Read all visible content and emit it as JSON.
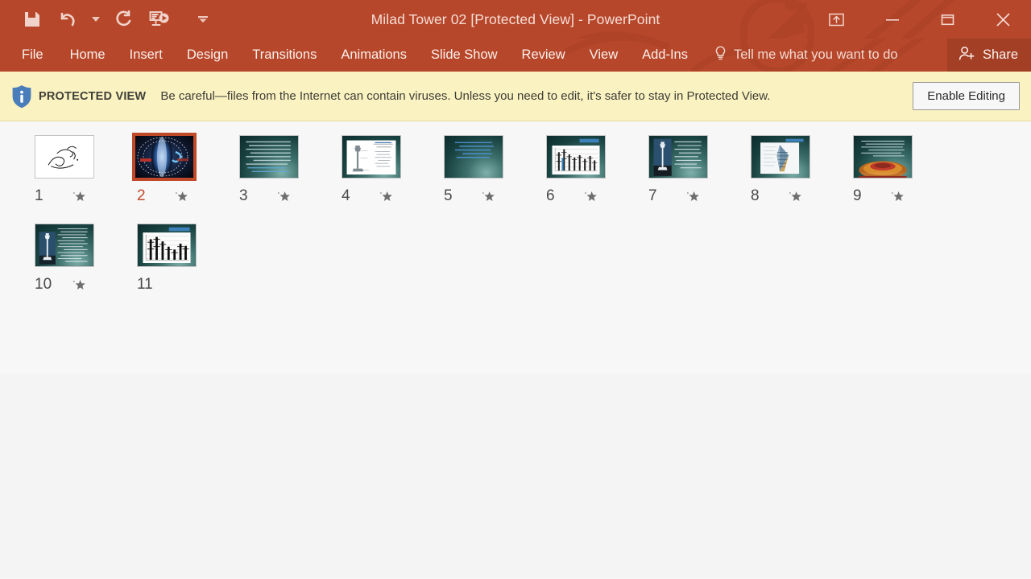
{
  "window": {
    "title": "Milad Tower 02 [Protected View] - PowerPoint",
    "accent_color": "#b7472a",
    "share_bg": "#a23f25"
  },
  "quick_access": [
    {
      "name": "save",
      "icon": "save-icon",
      "label": "Save"
    },
    {
      "name": "undo",
      "icon": "undo-icon",
      "label": "Undo"
    },
    {
      "name": "redo",
      "icon": "redo-icon",
      "label": "Redo"
    },
    {
      "name": "present",
      "icon": "start-presentation-icon",
      "label": "Start From Beginning"
    },
    {
      "name": "customize",
      "icon": "chevron-down-icon",
      "label": "Customize Quick Access Toolbar"
    }
  ],
  "window_controls": [
    {
      "name": "ribbon-display-options",
      "icon": "ribbon-options-icon",
      "glyph": "⬆"
    },
    {
      "name": "minimize",
      "icon": "minimize-icon",
      "glyph": "—"
    },
    {
      "name": "maximize",
      "icon": "maximize-icon",
      "glyph": "⬜"
    },
    {
      "name": "close",
      "icon": "close-icon",
      "glyph": "✕"
    }
  ],
  "ribbon": {
    "tabs": [
      {
        "label": "File"
      },
      {
        "label": "Home"
      },
      {
        "label": "Insert"
      },
      {
        "label": "Design"
      },
      {
        "label": "Transitions"
      },
      {
        "label": "Animations"
      },
      {
        "label": "Slide Show"
      },
      {
        "label": "Review"
      },
      {
        "label": "View"
      },
      {
        "label": "Add-Ins"
      }
    ],
    "tell_me_placeholder": "Tell me what you want to do",
    "share_label": "Share"
  },
  "protected_view": {
    "label": "PROTECTED VIEW",
    "message": "Be careful—files from the Internet can contain viruses. Unless you need to edit, it's safer to stay in Protected View.",
    "button_label": "Enable Editing",
    "bar_color": "#faf2c0",
    "shield_color": "#4a7ebb"
  },
  "slides": [
    {
      "number": "1",
      "selected": false,
      "has_animation": true,
      "style": "white-calligraphy"
    },
    {
      "number": "2",
      "selected": true,
      "has_animation": true,
      "style": "dark-blue-title"
    },
    {
      "number": "3",
      "selected": false,
      "has_animation": true,
      "style": "teal-text"
    },
    {
      "number": "4",
      "selected": false,
      "has_animation": true,
      "style": "teal-white-diagram"
    },
    {
      "number": "5",
      "selected": false,
      "has_animation": true,
      "style": "teal-blue-text"
    },
    {
      "number": "6",
      "selected": false,
      "has_animation": true,
      "style": "teal-chart"
    },
    {
      "number": "7",
      "selected": false,
      "has_animation": true,
      "style": "teal-tower-photo"
    },
    {
      "number": "8",
      "selected": false,
      "has_animation": true,
      "style": "teal-structure"
    },
    {
      "number": "9",
      "selected": false,
      "has_animation": true,
      "style": "teal-amber-structure"
    },
    {
      "number": "10",
      "selected": false,
      "has_animation": true,
      "style": "teal-tower-text"
    },
    {
      "number": "11",
      "selected": false,
      "has_animation": false,
      "style": "white-chart"
    }
  ]
}
